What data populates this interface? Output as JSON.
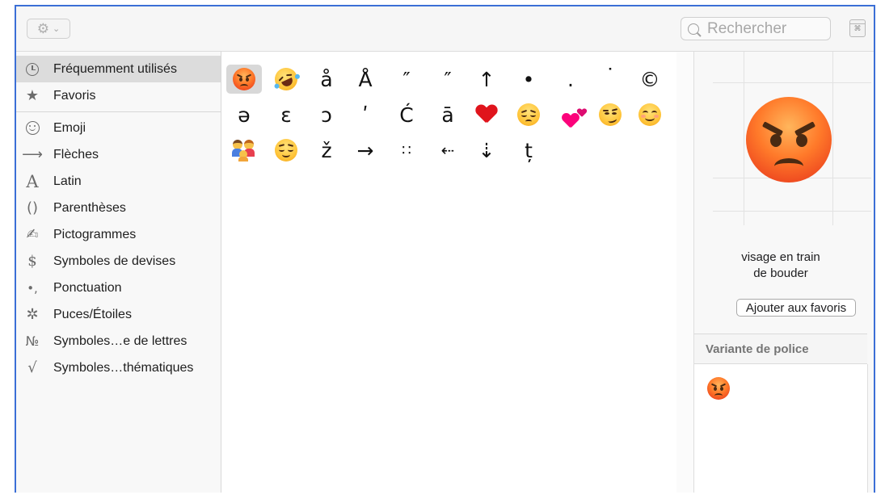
{
  "toolbar": {
    "gear_icon": "⚙",
    "chevron_icon": "⌄",
    "search_placeholder": "Rechercher",
    "viewer_icon": "⌘"
  },
  "sidebar": {
    "items": [
      {
        "label": "Fréquemment utilisés",
        "icon": "clock-icon",
        "selected": true
      },
      {
        "label": "Favoris",
        "icon": "★"
      },
      {
        "label": "Emoji",
        "icon": "smiley-icon"
      },
      {
        "label": "Flèches",
        "icon": "⟶"
      },
      {
        "label": "Latin",
        "icon": "A"
      },
      {
        "label": "Parenthèses",
        "icon": "()"
      },
      {
        "label": "Pictogrammes",
        "icon": "✍"
      },
      {
        "label": "Symboles de devises",
        "icon": "$"
      },
      {
        "label": "Ponctuation",
        "icon": "•,"
      },
      {
        "label": "Puces/Étoiles",
        "icon": "✲"
      },
      {
        "label": "Symboles…e de lettres",
        "icon": "№"
      },
      {
        "label": "Symboles…thématiques",
        "icon": "√"
      }
    ]
  },
  "grid": {
    "row1": [
      "angry-face-emoji",
      "rofl-emoji",
      "å",
      "Å",
      "″",
      "″",
      "↑",
      "•",
      ".",
      "˙",
      "©"
    ],
    "row2": [
      "ə",
      "ɛ",
      "ɔ",
      "ʹ",
      "Ć",
      "ā",
      "red-heart-emoji",
      "pensive-face-emoji",
      "two-hearts-emoji",
      "smirk-emoji",
      "smiling-face-emoji"
    ],
    "row3": [
      "family-emoji",
      "relieved-face-emoji",
      "ž",
      "→",
      "∷",
      "⇠",
      "⇣",
      "ț"
    ]
  },
  "detail": {
    "character_name_line1": "visage en train",
    "character_name_line2": "de bouder",
    "favorite_button": "Ajouter aux favoris",
    "variants_heading": "Variante de police"
  },
  "colors": {
    "selection_border": "#3b6fd6",
    "angry_face": "#ff6b2a",
    "heart": "#e0141c"
  }
}
